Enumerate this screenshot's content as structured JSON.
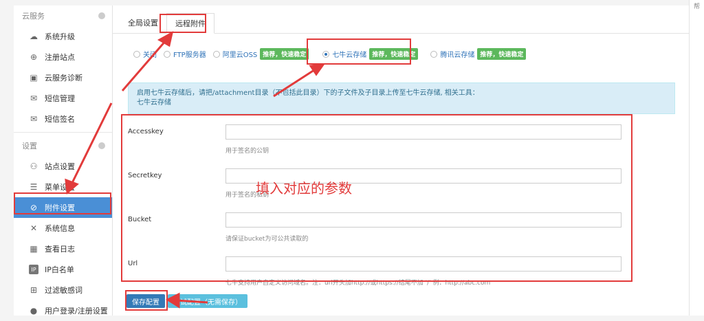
{
  "sidebar": {
    "groups": [
      {
        "title": "云服务",
        "items": [
          {
            "label": "系统升级",
            "icon": "cloud-upload-icon"
          },
          {
            "label": "注册站点",
            "icon": "plus-circle-icon"
          },
          {
            "label": "云服务诊断",
            "icon": "medkit-icon"
          },
          {
            "label": "短信管理",
            "icon": "envelope-icon"
          },
          {
            "label": "短信签名",
            "icon": "envelope-icon"
          }
        ]
      },
      {
        "title": "设置",
        "items": [
          {
            "label": "站点设置",
            "icon": "sitemap-icon"
          },
          {
            "label": "菜单设置",
            "icon": "list-icon"
          },
          {
            "label": "附件设置",
            "icon": "paperclip-icon",
            "active": true
          },
          {
            "label": "系统信息",
            "icon": "tools-icon"
          },
          {
            "label": "查看日志",
            "icon": "calendar-icon"
          },
          {
            "label": "IP白名单",
            "icon": "ip-icon"
          },
          {
            "label": "过滤敏感词",
            "icon": "filter-icon"
          },
          {
            "label": "用户登录/注册设置",
            "icon": "user-icon"
          }
        ]
      }
    ]
  },
  "tabs": [
    "全局设置",
    "远程附件"
  ],
  "storage_options": [
    {
      "label": "关闭",
      "tag": ""
    },
    {
      "label": "FTP服务器",
      "tag": ""
    },
    {
      "label": "阿里云OSS",
      "tag": "推荐，快速稳定"
    },
    {
      "label": "七牛云存储",
      "tag": "推荐，快速稳定",
      "selected": true
    },
    {
      "label": "腾讯云存储",
      "tag": "推荐，快速稳定"
    }
  ],
  "info": {
    "line1": "启用七牛云存储后，请把/attachment目录（不包括此目录）下的子文件及子目录上传至七牛云存储, 相关工具：",
    "line2": "七牛云存储"
  },
  "fields": [
    {
      "label": "Accesskey",
      "value": "",
      "hint": "用于签名的公钥"
    },
    {
      "label": "Secretkey",
      "value": "",
      "hint": "用于签名的私钥"
    },
    {
      "label": "Bucket",
      "value": "",
      "hint": "请保证bucket为可公共读取的"
    },
    {
      "label": "Url",
      "value": "",
      "hint": "七牛支持用户自定义访问域名。注：url开头加http://或https://结尾不加 '/' 例：http://abc.com"
    }
  ],
  "buttons": {
    "save": "保存配置",
    "test": "测试配置（无需保存）"
  },
  "annotation_text": "填入对应的参数",
  "scrollbar_text": "帮",
  "colors": {
    "accent": "#4a8fd6",
    "tag": "#5cb85c",
    "annotation": "#e23b3b"
  }
}
